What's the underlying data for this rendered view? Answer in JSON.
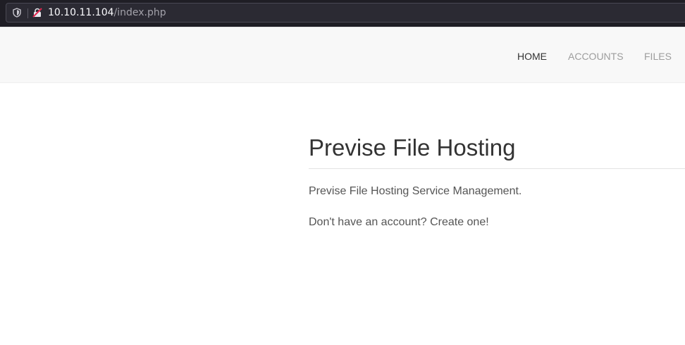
{
  "browser": {
    "url_host": "10.10.11.104",
    "url_path": "/index.php",
    "shield_icon": "shield-icon",
    "lock_icon": "insecure-lock-icon"
  },
  "navbar": {
    "items": [
      {
        "label": "HOME",
        "active": true
      },
      {
        "label": "ACCOUNTS",
        "active": false
      },
      {
        "label": "FILES",
        "active": false
      }
    ]
  },
  "main": {
    "title": "Previse File Hosting",
    "lead": "Previse File Hosting Service Management.",
    "account_prompt": "Don't have an account? Create one!"
  },
  "colors": {
    "chrome_bg": "#1f1e25",
    "navbar_bg": "#f8f8f8",
    "nav_active": "#333333",
    "nav_inactive": "#9d9d9d",
    "body_text": "#555555"
  }
}
